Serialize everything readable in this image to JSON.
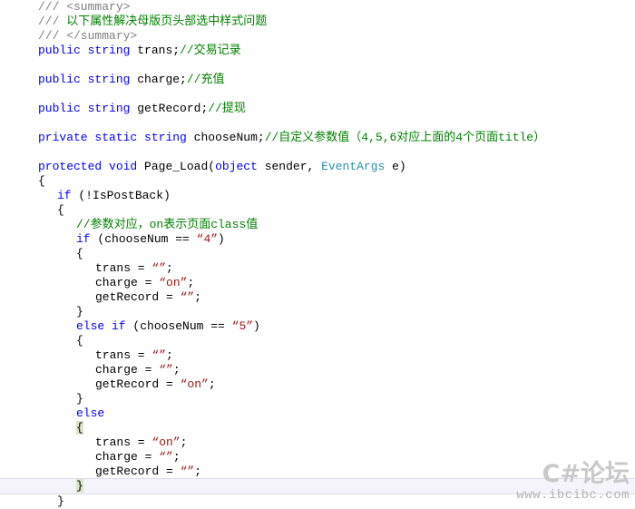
{
  "editor": {
    "language": "C#",
    "theme": "visual-studio-light",
    "background": "#ffffff",
    "colors": {
      "keyword": "#0000ff",
      "type": "#2b91af",
      "string": "#a31515",
      "comment": "#008000",
      "doc_comment": "#808080",
      "plain_text": "#000000",
      "current_line_band": "#f4f4fa",
      "current_line_border": "#dcdcea",
      "brace_match_highlight": "#dce4c8"
    },
    "lines": [
      {
        "n": 1,
        "indent": 0,
        "tokens": [
          {
            "t": "doc",
            "s": "/// <summary>"
          }
        ]
      },
      {
        "n": 2,
        "indent": 0,
        "tokens": [
          {
            "t": "doc",
            "s": "/// "
          },
          {
            "t": "cmt",
            "s": "以下属性解决母版页头部选中样式问题"
          }
        ]
      },
      {
        "n": 3,
        "indent": 0,
        "tokens": [
          {
            "t": "doc",
            "s": "/// </summary>"
          }
        ]
      },
      {
        "n": 4,
        "indent": 0,
        "tokens": [
          {
            "t": "kw",
            "s": "public"
          },
          {
            "t": "plain",
            "s": " "
          },
          {
            "t": "kw",
            "s": "string"
          },
          {
            "t": "plain",
            "s": " trans;"
          },
          {
            "t": "cmt",
            "s": "//交易记录"
          }
        ]
      },
      {
        "n": 5,
        "indent": 0,
        "tokens": []
      },
      {
        "n": 6,
        "indent": 0,
        "tokens": [
          {
            "t": "kw",
            "s": "public"
          },
          {
            "t": "plain",
            "s": " "
          },
          {
            "t": "kw",
            "s": "string"
          },
          {
            "t": "plain",
            "s": " charge;"
          },
          {
            "t": "cmt",
            "s": "//充值"
          }
        ]
      },
      {
        "n": 7,
        "indent": 0,
        "tokens": []
      },
      {
        "n": 8,
        "indent": 0,
        "tokens": [
          {
            "t": "kw",
            "s": "public"
          },
          {
            "t": "plain",
            "s": " "
          },
          {
            "t": "kw",
            "s": "string"
          },
          {
            "t": "plain",
            "s": " getRecord;"
          },
          {
            "t": "cmt",
            "s": "//提现"
          }
        ]
      },
      {
        "n": 9,
        "indent": 0,
        "tokens": []
      },
      {
        "n": 10,
        "indent": 0,
        "tokens": [
          {
            "t": "kw",
            "s": "private"
          },
          {
            "t": "plain",
            "s": " "
          },
          {
            "t": "kw",
            "s": "static"
          },
          {
            "t": "plain",
            "s": " "
          },
          {
            "t": "kw",
            "s": "string"
          },
          {
            "t": "plain",
            "s": " chooseNum;"
          },
          {
            "t": "cmt",
            "s": "//自定义参数值（4,5,6对应上面的4个页面title）"
          }
        ]
      },
      {
        "n": 11,
        "indent": 0,
        "tokens": []
      },
      {
        "n": 12,
        "indent": 0,
        "tokens": [
          {
            "t": "kw",
            "s": "protected"
          },
          {
            "t": "plain",
            "s": " "
          },
          {
            "t": "kw",
            "s": "void"
          },
          {
            "t": "plain",
            "s": " Page_Load("
          },
          {
            "t": "kw",
            "s": "object"
          },
          {
            "t": "plain",
            "s": " sender, "
          },
          {
            "t": "type",
            "s": "EventArgs"
          },
          {
            "t": "plain",
            "s": " e)"
          }
        ]
      },
      {
        "n": 13,
        "indent": 0,
        "tokens": [
          {
            "t": "plain",
            "s": "{"
          }
        ]
      },
      {
        "n": 14,
        "indent": 1,
        "tokens": [
          {
            "t": "kw",
            "s": "if"
          },
          {
            "t": "plain",
            "s": " (!IsPostBack)"
          }
        ]
      },
      {
        "n": 15,
        "indent": 1,
        "tokens": [
          {
            "t": "plain",
            "s": "{"
          }
        ]
      },
      {
        "n": 16,
        "indent": 2,
        "tokens": [
          {
            "t": "cmt",
            "s": "//参数对应，on表示页面class值"
          }
        ]
      },
      {
        "n": 17,
        "indent": 2,
        "tokens": [
          {
            "t": "kw",
            "s": "if"
          },
          {
            "t": "plain",
            "s": " (chooseNum == "
          },
          {
            "t": "str",
            "s": "“4”"
          },
          {
            "t": "plain",
            "s": ")"
          }
        ]
      },
      {
        "n": 18,
        "indent": 2,
        "tokens": [
          {
            "t": "plain",
            "s": "{"
          }
        ]
      },
      {
        "n": 19,
        "indent": 3,
        "tokens": [
          {
            "t": "plain",
            "s": "trans = "
          },
          {
            "t": "str",
            "s": "“”"
          },
          {
            "t": "plain",
            "s": ";"
          }
        ]
      },
      {
        "n": 20,
        "indent": 3,
        "tokens": [
          {
            "t": "plain",
            "s": "charge = "
          },
          {
            "t": "str",
            "s": "“on”"
          },
          {
            "t": "plain",
            "s": ";"
          }
        ]
      },
      {
        "n": 21,
        "indent": 3,
        "tokens": [
          {
            "t": "plain",
            "s": "getRecord = "
          },
          {
            "t": "str",
            "s": "“”"
          },
          {
            "t": "plain",
            "s": ";"
          }
        ]
      },
      {
        "n": 22,
        "indent": 2,
        "tokens": [
          {
            "t": "plain",
            "s": "}"
          }
        ]
      },
      {
        "n": 23,
        "indent": 2,
        "tokens": [
          {
            "t": "kw",
            "s": "else if"
          },
          {
            "t": "plain",
            "s": " (chooseNum == "
          },
          {
            "t": "str",
            "s": "“5”"
          },
          {
            "t": "plain",
            "s": ")"
          }
        ]
      },
      {
        "n": 24,
        "indent": 2,
        "tokens": [
          {
            "t": "plain",
            "s": "{"
          }
        ]
      },
      {
        "n": 25,
        "indent": 3,
        "tokens": [
          {
            "t": "plain",
            "s": "trans = "
          },
          {
            "t": "str",
            "s": "“”"
          },
          {
            "t": "plain",
            "s": ";"
          }
        ]
      },
      {
        "n": 26,
        "indent": 3,
        "tokens": [
          {
            "t": "plain",
            "s": "charge = "
          },
          {
            "t": "str",
            "s": "“”"
          },
          {
            "t": "plain",
            "s": ";"
          }
        ]
      },
      {
        "n": 27,
        "indent": 3,
        "tokens": [
          {
            "t": "plain",
            "s": "getRecord = "
          },
          {
            "t": "str",
            "s": "“on”"
          },
          {
            "t": "plain",
            "s": ";"
          }
        ]
      },
      {
        "n": 28,
        "indent": 2,
        "tokens": [
          {
            "t": "plain",
            "s": "}"
          }
        ]
      },
      {
        "n": 29,
        "indent": 2,
        "tokens": [
          {
            "t": "kw",
            "s": "else"
          }
        ]
      },
      {
        "n": 30,
        "indent": 2,
        "tokens": [
          {
            "t": "plain",
            "s": "{",
            "hl": true
          }
        ]
      },
      {
        "n": 31,
        "indent": 3,
        "tokens": [
          {
            "t": "plain",
            "s": "trans = "
          },
          {
            "t": "str",
            "s": "“on”"
          },
          {
            "t": "plain",
            "s": ";"
          }
        ]
      },
      {
        "n": 32,
        "indent": 3,
        "tokens": [
          {
            "t": "plain",
            "s": "charge = "
          },
          {
            "t": "str",
            "s": "“”"
          },
          {
            "t": "plain",
            "s": ";"
          }
        ]
      },
      {
        "n": 33,
        "indent": 3,
        "tokens": [
          {
            "t": "plain",
            "s": "getRecord = "
          },
          {
            "t": "str",
            "s": "“”"
          },
          {
            "t": "plain",
            "s": ";"
          }
        ]
      },
      {
        "n": 34,
        "indent": 2,
        "band": true,
        "tokens": [
          {
            "t": "plain",
            "s": "}",
            "hl": true
          }
        ]
      },
      {
        "n": 35,
        "indent": 1,
        "tokens": [
          {
            "t": "plain",
            "s": "}"
          }
        ]
      }
    ]
  },
  "watermark": {
    "title": "C#论坛",
    "url": "www.ibcibc.com"
  }
}
